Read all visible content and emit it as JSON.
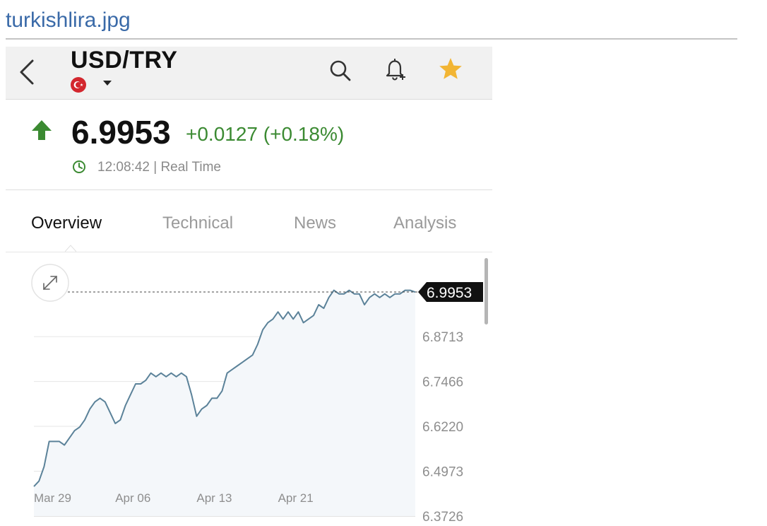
{
  "file_title": "turkishlira.jpg",
  "header": {
    "symbol": "USD/TRY"
  },
  "quote": {
    "price": "6.9953",
    "change": "+0.0127 (+0.18%)",
    "time": "12:08:42 | Real Time",
    "colors": {
      "up": "#3b8a32",
      "star": "#f2b534"
    }
  },
  "tabs": [
    {
      "label": "Overview",
      "active": true
    },
    {
      "label": "Technical",
      "active": false
    },
    {
      "label": "News",
      "active": false
    },
    {
      "label": "Analysis",
      "active": false
    }
  ],
  "chart_data": {
    "type": "line",
    "x_tick_labels": [
      "Mar 29",
      "Apr 06",
      "Apr 13",
      "Apr 21"
    ],
    "x_tick_index": [
      0,
      16,
      32,
      48
    ],
    "y_tick_labels": [
      "6.8713",
      "6.7466",
      "6.6220",
      "6.4973",
      "6.3726"
    ],
    "y_ticks": [
      6.8713,
      6.7466,
      6.622,
      6.4973,
      6.3726
    ],
    "ylim": [
      6.3726,
      6.9953
    ],
    "last_value_label": "6.9953",
    "last_value": 6.9953,
    "grid": true,
    "line_color": "#5b8299",
    "series": [
      {
        "values": [
          6.455,
          6.47,
          6.51,
          6.58,
          6.58,
          6.58,
          6.57,
          6.59,
          6.61,
          6.62,
          6.64,
          6.67,
          6.69,
          6.7,
          6.69,
          6.66,
          6.63,
          6.64,
          6.68,
          6.71,
          6.74,
          6.74,
          6.75,
          6.77,
          6.76,
          6.77,
          6.76,
          6.77,
          6.76,
          6.77,
          6.76,
          6.71,
          6.65,
          6.67,
          6.68,
          6.7,
          6.7,
          6.72,
          6.77,
          6.78,
          6.79,
          6.8,
          6.81,
          6.82,
          6.85,
          6.89,
          6.91,
          6.92,
          6.94,
          6.92,
          6.94,
          6.92,
          6.94,
          6.91,
          6.92,
          6.93,
          6.96,
          6.95,
          6.98,
          7.0,
          6.99,
          6.99,
          7.0,
          6.99,
          6.99,
          6.96,
          6.98,
          6.99,
          6.98,
          6.99,
          6.98,
          6.99,
          6.99,
          7.0,
          7.0,
          6.995
        ]
      }
    ]
  }
}
